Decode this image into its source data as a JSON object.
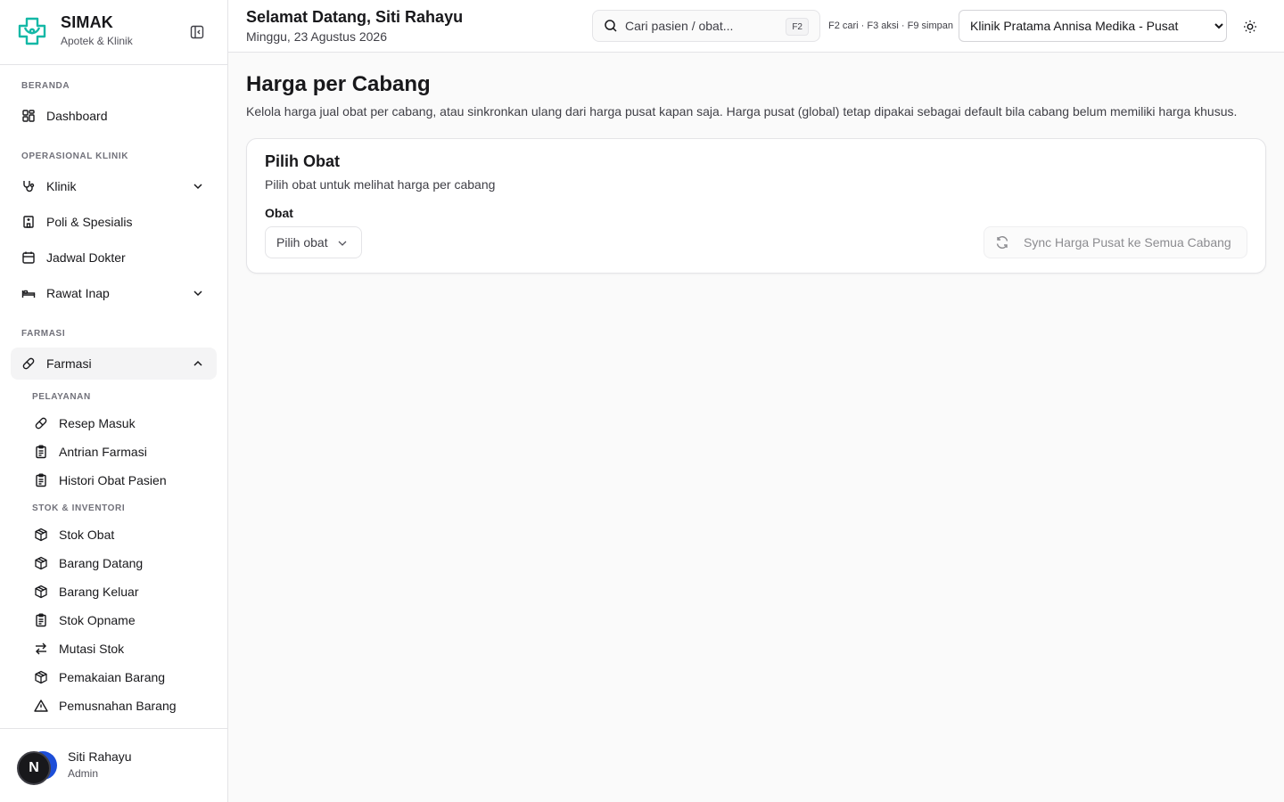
{
  "brand": {
    "name": "SIMAK",
    "subtitle": "Apotek & Klinik"
  },
  "header": {
    "greeting": "Selamat Datang, Siti Rahayu",
    "date": "Minggu, 23 Agustus 2026",
    "search_placeholder": "Cari pasien / obat...",
    "search_kbd": "F2",
    "shortcuts": "F2 cari · F3 aksi · F9 simpan",
    "branch_selected": "Klinik Pratama Annisa Medika - Pusat"
  },
  "sidebar": {
    "sections": {
      "beranda": "BERANDA",
      "operasional": "OPERASIONAL KLINIK",
      "farmasi": "FARMASI"
    },
    "items": {
      "dashboard": "Dashboard",
      "klinik": "Klinik",
      "poli": "Poli & Spesialis",
      "jadwal": "Jadwal Dokter",
      "rawat_inap": "Rawat Inap",
      "farmasi": "Farmasi"
    },
    "farmasi_sub": {
      "pelayanan_label": "PELAYANAN",
      "resep_masuk": "Resep Masuk",
      "antrian": "Antrian Farmasi",
      "histori": "Histori Obat Pasien",
      "stok_label": "STOK & INVENTORI",
      "stok_obat": "Stok Obat",
      "barang_datang": "Barang Datang",
      "barang_keluar": "Barang Keluar",
      "stok_opname": "Stok Opname",
      "mutasi": "Mutasi Stok",
      "pemakaian": "Pemakaian Barang",
      "pemusnahan": "Pemusnahan Barang"
    }
  },
  "user": {
    "initial": "N",
    "name": "Siti Rahayu",
    "role": "Admin"
  },
  "main": {
    "title": "Harga per Cabang",
    "description": "Kelola harga jual obat per cabang, atau sinkronkan ulang dari harga pusat kapan saja. Harga pusat (global) tetap dipakai sebagai default bila cabang belum memiliki harga khusus.",
    "card": {
      "title": "Pilih Obat",
      "description": "Pilih obat untuk melihat harga per cabang",
      "field_label": "Obat",
      "select_placeholder": "Pilih obat",
      "sync_button": "Sync Harga Pusat ke Semua Cabang"
    }
  },
  "colors": {
    "brand_accent": "#14b8a6",
    "text": "#18181b",
    "muted": "#3f3f46",
    "border": "#e4e4e7"
  }
}
